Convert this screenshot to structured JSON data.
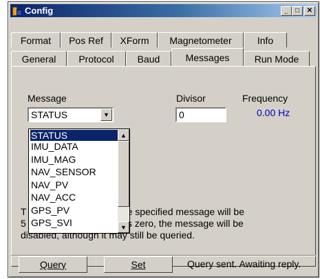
{
  "window": {
    "title": "Config"
  },
  "tabs": {
    "row1": [
      "Format",
      "Pos Ref",
      "XForm",
      "Magnetometer",
      "Info"
    ],
    "row2": [
      "General",
      "Protocol",
      "Baud",
      "Messages",
      "Run Mode"
    ],
    "active": "Messages"
  },
  "form": {
    "message_label": "Message",
    "message_value": "STATUS",
    "divisor_label": "Divisor",
    "divisor_value": "0",
    "frequency_label": "Frequency",
    "frequency_value": "0.00 Hz"
  },
  "dropdown": {
    "options": [
      "STATUS",
      "IMU_DATA",
      "IMU_MAG",
      "NAV_SENSOR",
      "NAV_PV",
      "NAV_ACC",
      "GPS_PV",
      "GPS_SVI"
    ],
    "selected_index": 0
  },
  "description": {
    "line1_start": "T",
    "line1_end": "e specified message will be",
    "line2_start": "5",
    "line2_end": "is zero, the message will be",
    "line3": "disabled, although it may still be queried."
  },
  "buttons": {
    "query": "Query",
    "set": "Set"
  },
  "status": "Query sent. Awaiting reply.",
  "colors": {
    "titlebar_start": "#0a246a",
    "selection": "#0a246a",
    "frequency_text": "#0000c0"
  }
}
